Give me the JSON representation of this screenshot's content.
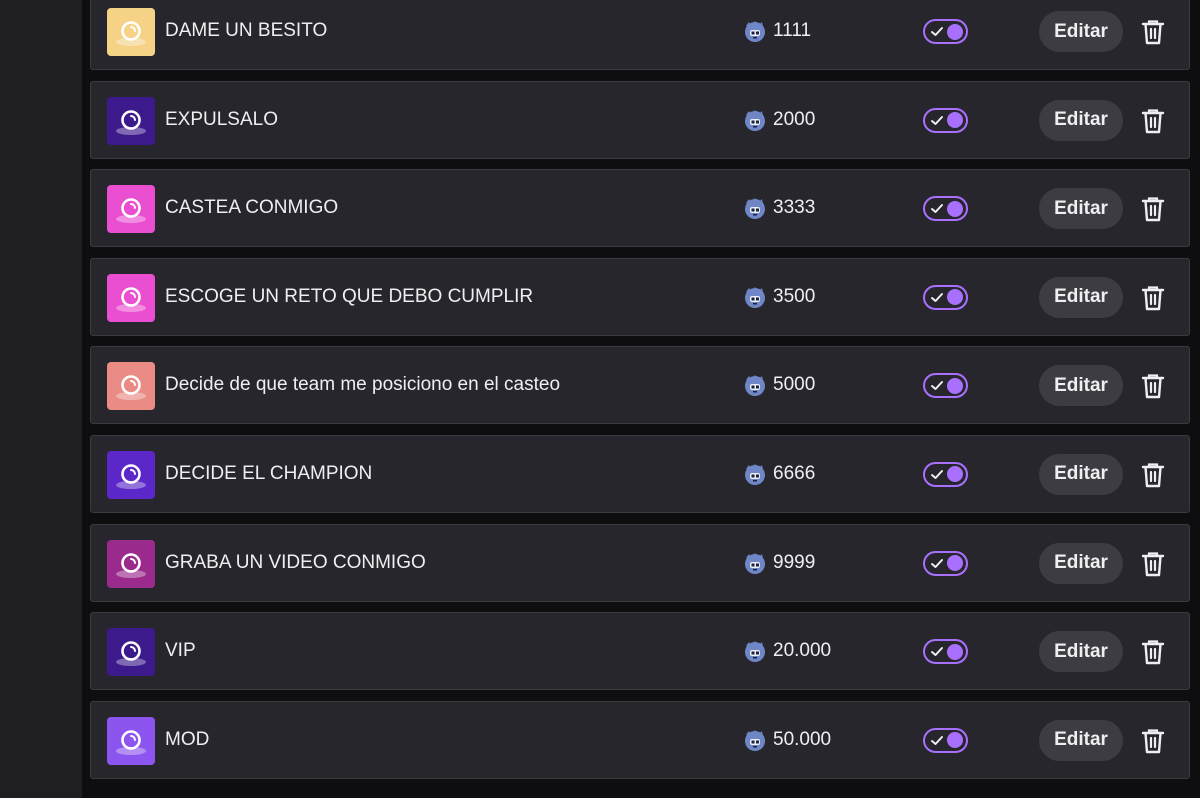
{
  "colors": {
    "accent": "#a970ff",
    "row_bg": "#26262c",
    "text": "#efeff1",
    "button_bg": "#3c3c42"
  },
  "rewards": [
    {
      "title": "DAME UN BESITO",
      "cost": "1111",
      "color": "#f5d286",
      "icon": "reward-icon",
      "enabled": true,
      "edit_label": "Editar"
    },
    {
      "title": "EXPULSALO",
      "cost": "2000",
      "color": "#3d1a8c",
      "icon": "reward-icon",
      "enabled": true,
      "edit_label": "Editar"
    },
    {
      "title": "CASTEA CONMIGO",
      "cost": "3333",
      "color": "#ea4fd1",
      "icon": "reward-icon",
      "enabled": true,
      "edit_label": "Editar"
    },
    {
      "title": "ESCOGE UN RETO QUE DEBO CUMPLIR",
      "cost": "3500",
      "color": "#ea4fd1",
      "icon": "reward-icon",
      "enabled": true,
      "edit_label": "Editar"
    },
    {
      "title": "Decide de que team me posiciono en el casteo",
      "cost": "5000",
      "color": "#ea8b86",
      "icon": "reward-icon",
      "enabled": true,
      "edit_label": "Editar"
    },
    {
      "title": "DECIDE EL CHAMPION",
      "cost": "6666",
      "color": "#5b27c9",
      "icon": "reward-icon",
      "enabled": true,
      "edit_label": "Editar"
    },
    {
      "title": "GRABA UN VIDEO CONMIGO",
      "cost": "9999",
      "color": "#9a2a8c",
      "icon": "reward-icon",
      "enabled": true,
      "edit_label": "Editar"
    },
    {
      "title": "VIP",
      "cost": "20.000",
      "color": "#3d1a8c",
      "icon": "reward-icon",
      "enabled": true,
      "edit_label": "Editar"
    },
    {
      "title": "MOD",
      "cost": "50.000",
      "color": "#8d55f0",
      "icon": "reward-icon",
      "enabled": true,
      "edit_label": "Editar"
    }
  ]
}
